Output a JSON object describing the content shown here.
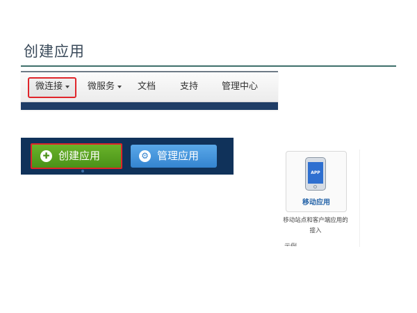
{
  "slide": {
    "title": "创建应用"
  },
  "navbar": {
    "items": [
      {
        "label": "微连接",
        "has_caret": true,
        "active": true
      },
      {
        "label": "微服务",
        "has_caret": true,
        "active": false
      },
      {
        "label": "文档",
        "has_caret": false,
        "active": false
      },
      {
        "label": "支持",
        "has_caret": false,
        "active": false
      },
      {
        "label": "管理中心",
        "has_caret": false,
        "active": false
      }
    ],
    "highlight_color": "#e0242a",
    "bottom_bar_color": "#1f3d66"
  },
  "buttons": {
    "create": {
      "label": "创建应用",
      "icon": "puzzle-icon",
      "color": "#4a9218"
    },
    "manage": {
      "label": "管理应用",
      "icon": "gear-icon",
      "color": "#3484d0"
    },
    "background_color": "#10325a"
  },
  "app_card": {
    "badge": "APP",
    "name": "移动应用",
    "description": "移动站点和客户端应用的接入",
    "icon": "mobile-phone-icon"
  },
  "colors": {
    "title_rule": "#3d6f6a",
    "highlight": "#e0242a"
  }
}
